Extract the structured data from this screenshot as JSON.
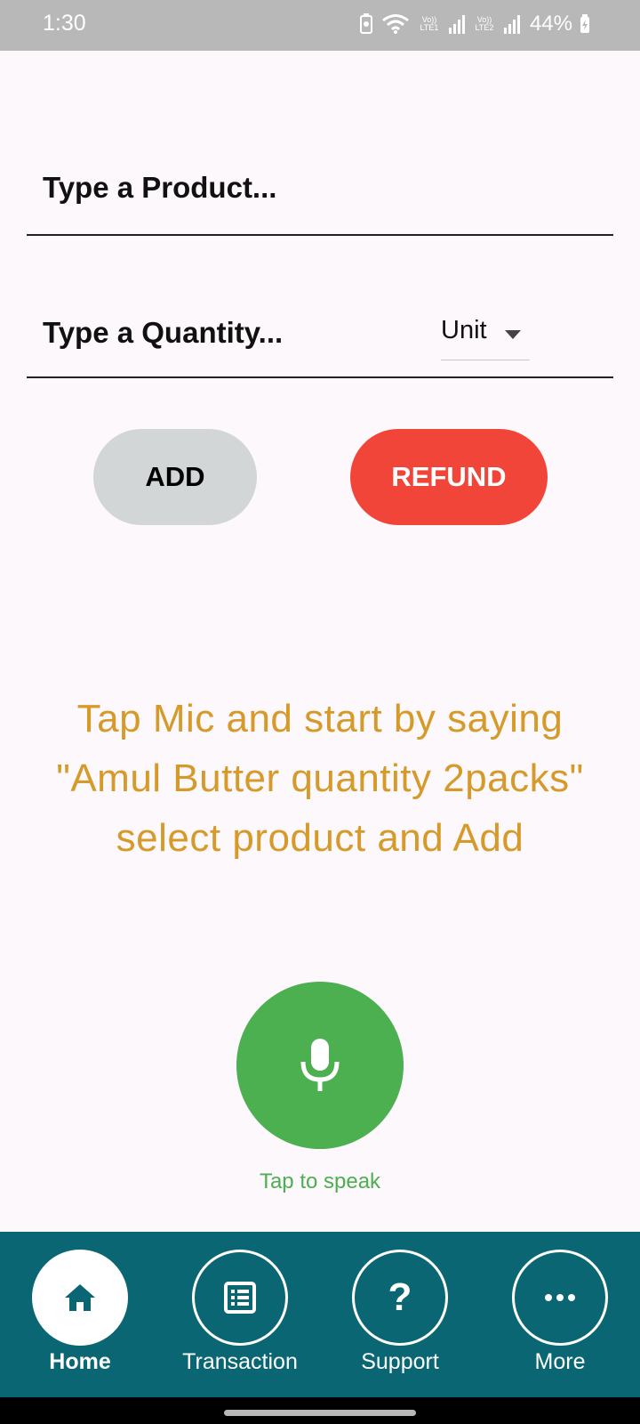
{
  "status_bar": {
    "time": "1:30",
    "network_1_label": "Vo)) LTE1",
    "network_2_label": "Vo)) LTE2",
    "battery": "44%"
  },
  "form": {
    "product_placeholder": "Type a Product...",
    "quantity_placeholder": "Type a Quantity...",
    "unit_selected": "Unit"
  },
  "buttons": {
    "add": "ADD",
    "refund": "REFUND"
  },
  "instruction": {
    "line1": "Tap Mic and start by saying",
    "line2": "\"Amul Butter quantity 2packs\"",
    "line3": "select product and Add"
  },
  "mic": {
    "label": "Tap to speak",
    "icon": "mic-icon"
  },
  "nav": {
    "items": [
      {
        "label": "Home",
        "icon": "home-icon",
        "active": true
      },
      {
        "label": "Transaction",
        "icon": "list-icon",
        "active": false
      },
      {
        "label": "Support",
        "icon": "question-icon",
        "active": false
      },
      {
        "label": "More",
        "icon": "more-icon",
        "active": false
      }
    ]
  },
  "colors": {
    "refund": "#f2453a",
    "add": "#d3d6d6",
    "mic": "#4caf50",
    "instruction": "#d69a2a",
    "nav_bg": "#0a6672"
  }
}
